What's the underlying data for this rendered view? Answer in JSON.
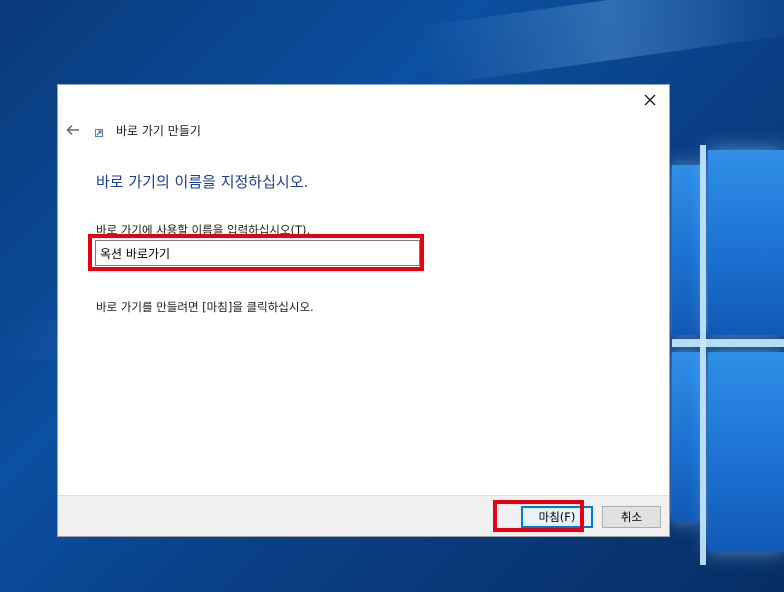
{
  "wizard": {
    "title": "바로 가기 만들기",
    "heading": "바로 가기의 이름을 지정하십시오.",
    "field_label": "바로 가기에 사용할 이름을 입력하십시오(T).",
    "name_value": "옥션 바로가기",
    "hint": "바로 가기를 만들려면 [마침]을 클릭하십시오."
  },
  "buttons": {
    "finish_label": "마침(F)",
    "cancel_label": "취소"
  },
  "icons": {
    "close": "close-icon",
    "back": "back-arrow-icon",
    "wizard": "shortcut-icon"
  },
  "colors": {
    "heading": "#1c3f8f",
    "highlight": "#e60012",
    "finish_border": "#0078d7"
  }
}
